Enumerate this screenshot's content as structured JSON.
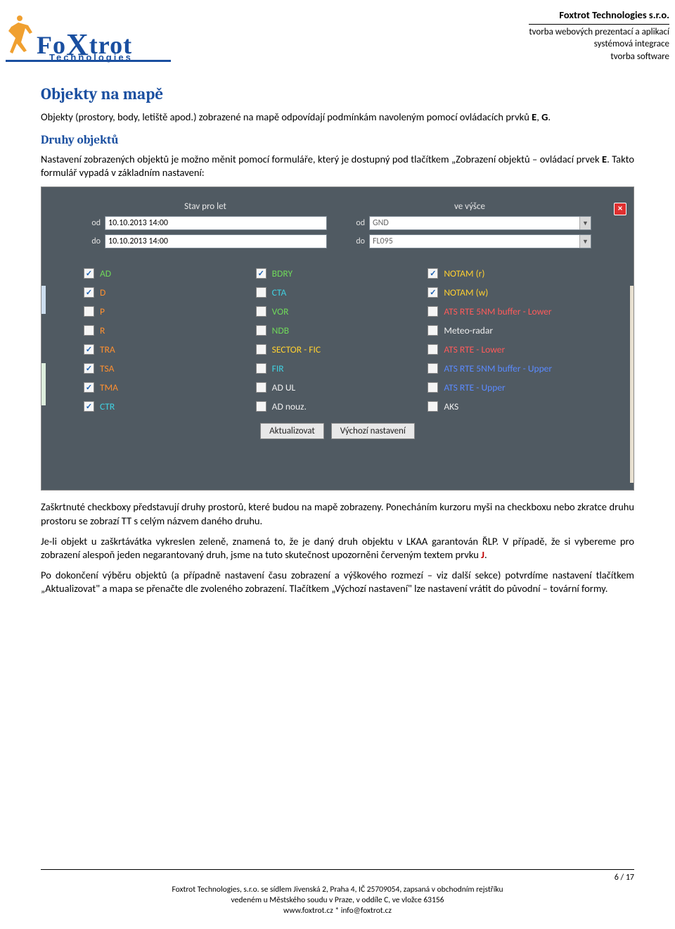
{
  "header": {
    "company": "Foxtrot Technologies s.r.o.",
    "lines": [
      "tvorba webových prezentací a aplikací",
      "systémová integrace",
      "tvorba software"
    ],
    "logo_main": "Fo",
    "logo_x": "X",
    "logo_rest": "trot",
    "logo_sub": "Technologies"
  },
  "h2": "Objekty na mapě",
  "p1a": "Objekty (prostory, body, letiště apod.) zobrazené na mapě odpovídají podmínkám navoleným pomocí ovládacích prvků ",
  "p1e": "E",
  "p1c": ", ",
  "p1g": "G",
  "p1end": ".",
  "h3": "Druhy objektů",
  "p2a": "Nastavení zobrazených objektů je možno měnit pomocí formuláře, který je dostupný pod tlačítkem „Zobrazení objektů – ovládací prvek ",
  "p2e": "E",
  "p2b": ". Takto formulář vypadá v základním nastavení:",
  "shot": {
    "close": "×",
    "top": {
      "left_title": "Stav pro let",
      "right_title": "ve výšce",
      "od": "od",
      "do": "do",
      "l_od": "10.10.2013 14:00",
      "l_do": "10.10.2013 14:00",
      "r_od": "GND",
      "r_do": "FL095"
    },
    "col1": [
      {
        "c": true,
        "t": "AD",
        "cl": "c-green"
      },
      {
        "c": true,
        "t": "D",
        "cl": "c-orange"
      },
      {
        "c": false,
        "t": "P",
        "cl": "c-orange"
      },
      {
        "c": false,
        "t": "R",
        "cl": "c-orange"
      },
      {
        "c": true,
        "t": "TRA",
        "cl": "c-orange"
      },
      {
        "c": true,
        "t": "TSA",
        "cl": "c-orange"
      },
      {
        "c": true,
        "t": "TMA",
        "cl": "c-orange"
      },
      {
        "c": true,
        "t": "CTR",
        "cl": "c-cyan"
      }
    ],
    "col2": [
      {
        "c": true,
        "t": "BDRY",
        "cl": "c-green"
      },
      {
        "c": false,
        "t": "CTA",
        "cl": "c-cyan"
      },
      {
        "c": false,
        "t": "VOR",
        "cl": "c-green"
      },
      {
        "c": false,
        "t": "NDB",
        "cl": "c-green"
      },
      {
        "c": false,
        "t": "SECTOR - FIC",
        "cl": "c-yellow"
      },
      {
        "c": false,
        "t": "FIR",
        "cl": "c-cyan"
      },
      {
        "c": false,
        "t": "AD UL",
        "cl": "c-white"
      },
      {
        "c": false,
        "t": "AD nouz.",
        "cl": "c-white"
      }
    ],
    "col3": [
      {
        "c": true,
        "t": "NOTAM (r)",
        "cl": "c-yellow"
      },
      {
        "c": true,
        "t": "NOTAM (w)",
        "cl": "c-yellow"
      },
      {
        "c": false,
        "t": "ATS RTE 5NM buffer - Lower",
        "cl": "c-red"
      },
      {
        "c": false,
        "t": "Meteo-radar",
        "cl": "c-white"
      },
      {
        "c": false,
        "t": "ATS RTE - Lower",
        "cl": "c-red"
      },
      {
        "c": false,
        "t": "ATS RTE 5NM buffer - Upper",
        "cl": "c-blue"
      },
      {
        "c": false,
        "t": "ATS RTE - Upper",
        "cl": "c-blue"
      },
      {
        "c": false,
        "t": "AKS",
        "cl": "c-white"
      }
    ],
    "btn1": "Aktualizovat",
    "btn2": "Výchozí nastavení"
  },
  "p3": "Zaškrtnuté checkboxy představují druhy prostorů, které budou na mapě zobrazeny. Ponecháním kurzoru myši na checkboxu nebo zkratce druhu prostoru se zobrazí TT s celým názvem daného druhu.",
  "p4a": "Je-li objekt u zaškrtávátka vykreslen zeleně, znamená to, že je daný druh objektu v LKAA garantován ŘLP. V případě, že si vybereme pro zobrazení alespoň jeden negarantovaný druh, jsme na tuto skutečnost upozorněni červeným textem prvku ",
  "p4j": "J",
  "p4end": ".",
  "p5": "Po dokončení výběru objektů (a případně nastavení času zobrazení a výškového rozmezí – viz další sekce) potvrdíme nastavení tlačítkem „Aktualizovat\" a mapa se přenačte dle zvoleného zobrazení. Tlačítkem „Výchozí nastavení\" lze nastavení vrátit do původní – tovární formy.",
  "footer": {
    "page": "6 / 17",
    "l1": "Foxtrot Technologies, s.r.o. se sídlem Jivenská 2, Praha 4, IČ 25709054, zapsaná v obchodním rejstříku",
    "l2": "vedeném u Městského soudu v Praze, v oddíle C, ve vložce 63156",
    "l3": "www.foxtrot.cz * info@foxtrot.cz"
  }
}
